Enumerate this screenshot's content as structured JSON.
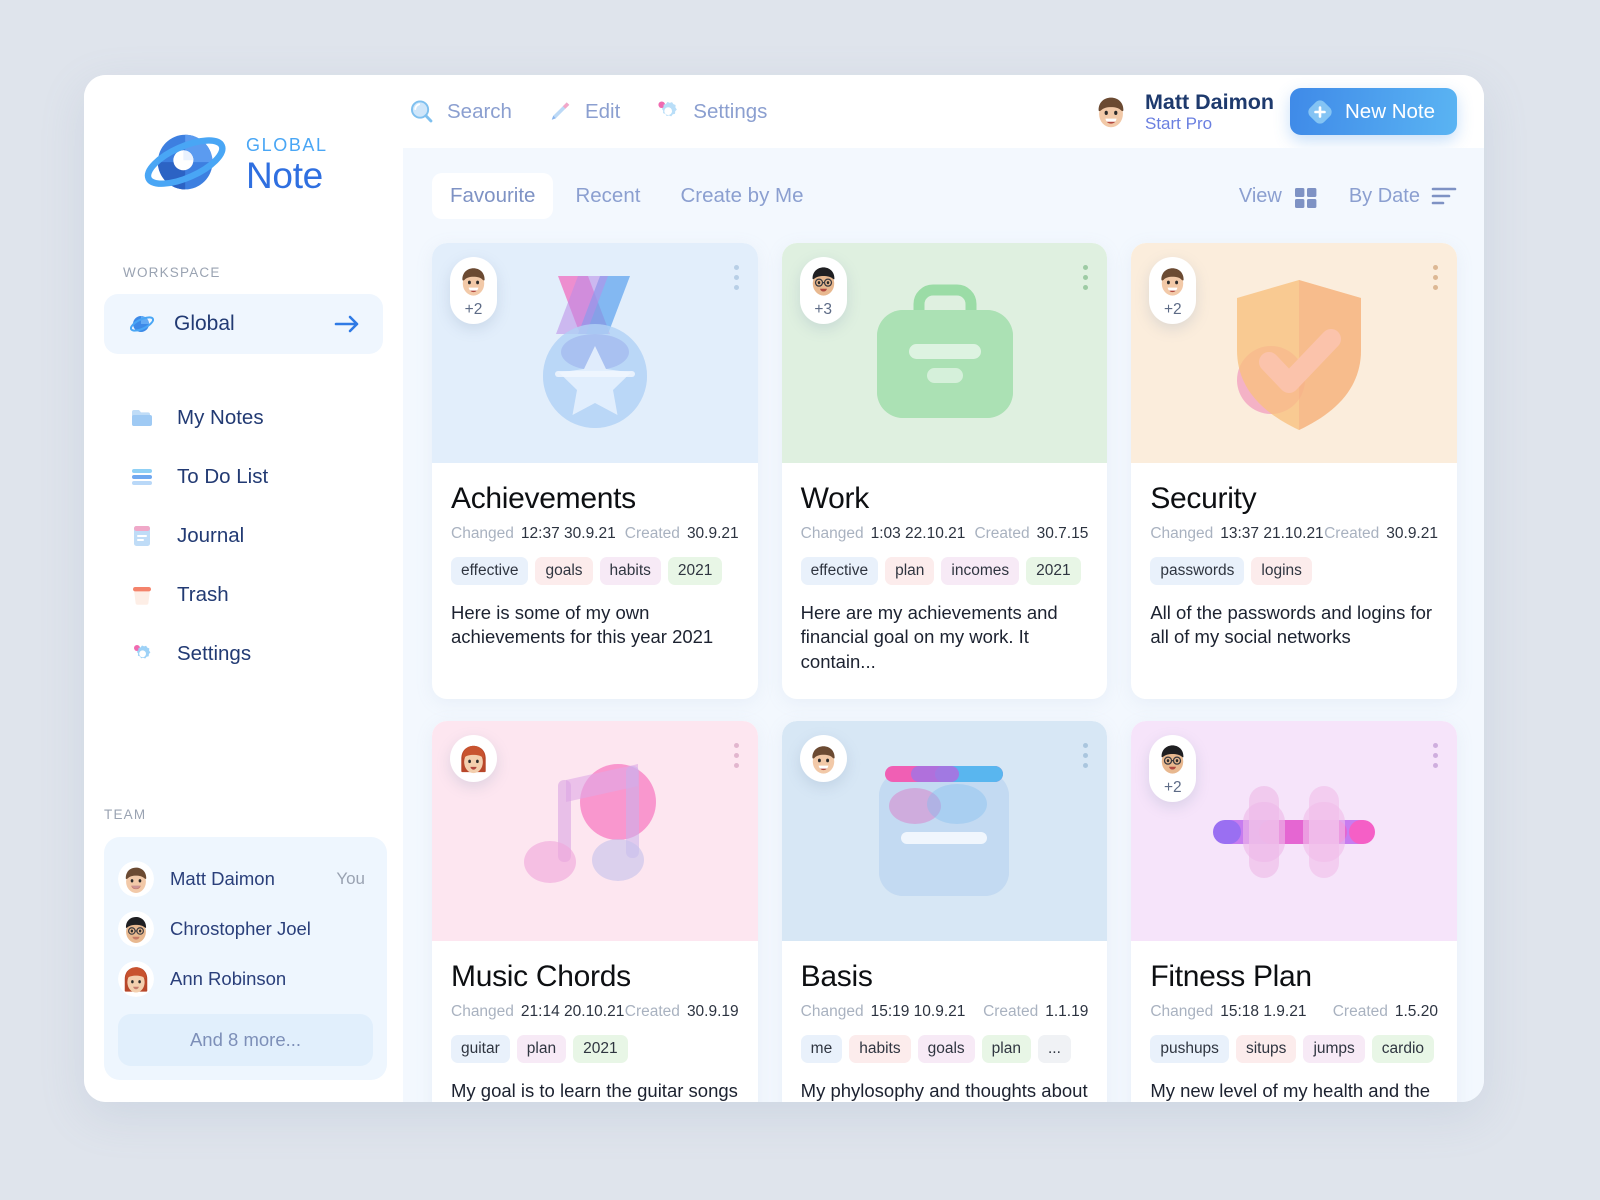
{
  "brand": {
    "top": "GLOBAL",
    "name": "Note",
    "icon": "planet-logo-icon"
  },
  "sidebar": {
    "workspace_label": "WORKSPACE",
    "workspace": {
      "name": "Global",
      "icon": "planet-icon",
      "arrow": "arrow-right-icon"
    },
    "nav": [
      {
        "label": "My Notes",
        "icon": "folder-icon"
      },
      {
        "label": "To Do List",
        "icon": "list-icon"
      },
      {
        "label": "Journal",
        "icon": "journal-icon"
      },
      {
        "label": "Trash",
        "icon": "trash-icon"
      },
      {
        "label": "Settings",
        "icon": "gear-icon"
      }
    ],
    "team_label": "TEAM",
    "team": [
      {
        "name": "Matt Daimon",
        "badge": "You",
        "avatar": "man-brown-hair-avatar"
      },
      {
        "name": "Chrostopher Joel",
        "badge": "",
        "avatar": "man-glasses-avatar"
      },
      {
        "name": "Ann Robinson",
        "badge": "",
        "avatar": "woman-red-hair-avatar"
      }
    ],
    "more_label": "And 8 more..."
  },
  "topbar": {
    "nav": [
      {
        "label": "Search",
        "icon": "search-icon"
      },
      {
        "label": "Edit",
        "icon": "pencil-icon"
      },
      {
        "label": "Settings",
        "icon": "gear-icon"
      }
    ],
    "user": {
      "name": "Matt Daimon",
      "plan": "Start Pro",
      "avatar": "man-brown-hair-avatar"
    },
    "new_note_label": "New Note",
    "new_note_icon": "plus-icon"
  },
  "toolbar": {
    "tabs": [
      {
        "label": "Favourite",
        "active": true
      },
      {
        "label": "Recent",
        "active": false
      },
      {
        "label": "Create by Me",
        "active": false
      }
    ],
    "view_label": "View",
    "view_icon": "grid-view-icon",
    "sort_label": "By Date",
    "sort_icon": "sort-lines-icon"
  },
  "labels": {
    "changed": "Changed",
    "created": "Created"
  },
  "cards": [
    {
      "title": "Achievements",
      "changed": "12:37 30.9.21",
      "created": "30.9.21",
      "tags": [
        {
          "text": "effective",
          "color": "t-blue"
        },
        {
          "text": "goals",
          "color": "t-pink"
        },
        {
          "text": "habits",
          "color": "t-purple"
        },
        {
          "text": "2021",
          "color": "t-green"
        }
      ],
      "excerpt": "Here is some of  my own achievements for this year 2021",
      "hero_bg": "#e2eefb",
      "hero_icon": "medal-icon",
      "avatar": "man-brown-hair-avatar",
      "extra_count": "+2",
      "dots_color": "#b8cfe6"
    },
    {
      "title": "Work",
      "changed": "1:03 22.10.21",
      "created": "30.7.15",
      "tags": [
        {
          "text": "effective",
          "color": "t-blue"
        },
        {
          "text": "plan",
          "color": "t-pink"
        },
        {
          "text": "incomes",
          "color": "t-purple"
        },
        {
          "text": "2021",
          "color": "t-green"
        }
      ],
      "excerpt": "Here are my achievements and financial goal on my work. It contain...",
      "hero_bg": "#dff0e0",
      "hero_icon": "briefcase-icon",
      "avatar": "man-glasses-avatar",
      "extra_count": "+3",
      "dots_color": "#9ecba4"
    },
    {
      "title": "Security",
      "changed": "13:37 21.10.21",
      "created": "30.9.21",
      "tags": [
        {
          "text": "passwords",
          "color": "t-blue"
        },
        {
          "text": "logins",
          "color": "t-pink"
        }
      ],
      "excerpt": "All of the passwords and logins for all of my social networks",
      "hero_bg": "#fbeddc",
      "hero_icon": "shield-check-icon",
      "avatar": "man-brown-hair-avatar",
      "extra_count": "+2",
      "dots_color": "#ddb894"
    },
    {
      "title": "Music Chords",
      "changed": "21:14 20.10.21",
      "created": "30.9.19",
      "tags": [
        {
          "text": "guitar",
          "color": "t-blue"
        },
        {
          "text": "plan",
          "color": "t-purple"
        },
        {
          "text": "2021",
          "color": "t-green"
        }
      ],
      "excerpt": "My goal is to learn the guitar songs and its chords",
      "hero_bg": "#fde6f0",
      "hero_icon": "music-note-icon",
      "avatar": "woman-red-hair-avatar",
      "extra_count": "",
      "dots_color": "#e2b6ce"
    },
    {
      "title": "Basis",
      "changed": "15:19 10.9.21",
      "created": "1.1.19",
      "tags": [
        {
          "text": "me",
          "color": "t-blue"
        },
        {
          "text": "habits",
          "color": "t-pink"
        },
        {
          "text": "goals",
          "color": "t-purple"
        },
        {
          "text": "plan",
          "color": "t-green"
        },
        {
          "text": "...",
          "color": "t-gray"
        }
      ],
      "excerpt": "My phylosophy and thoughts about anything in my life",
      "hero_bg": "#d7e7f5",
      "hero_icon": "notebook-icon",
      "avatar": "man-brown-hair-avatar",
      "extra_count": "",
      "dots_color": "#aac6de"
    },
    {
      "title": "Fitness Plan",
      "changed": "15:18 1.9.21",
      "created": "1.5.20",
      "tags": [
        {
          "text": "pushups",
          "color": "t-blue"
        },
        {
          "text": "situps",
          "color": "t-pink"
        },
        {
          "text": "jumps",
          "color": "t-purple"
        },
        {
          "text": "cardio",
          "color": "t-green"
        }
      ],
      "excerpt": "My new level of my health and the muscle trainings",
      "hero_bg": "#f6e4fa",
      "hero_icon": "dumbbell-icon",
      "avatar": "man-glasses-avatar",
      "extra_count": "+2",
      "dots_color": "#cfaede"
    }
  ]
}
